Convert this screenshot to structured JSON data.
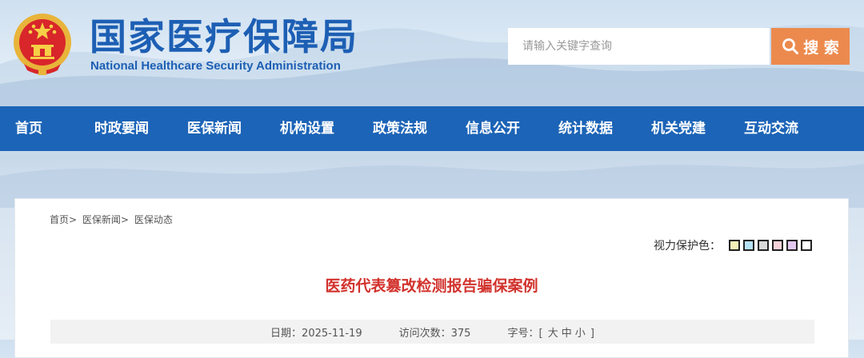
{
  "header": {
    "title_cn": "国家医疗保障局",
    "title_en": "National Healthcare Security Administration",
    "logo_icon": "national-emblem-icon"
  },
  "search": {
    "placeholder": "请输入关键字查询",
    "button_label": "搜 索",
    "button_icon": "search-icon",
    "button_color": "#ec8a4e"
  },
  "nav": {
    "color": "#1c64b7",
    "items": [
      "首页",
      "时政要闻",
      "医保新闻",
      "机构设置",
      "政策法规",
      "信息公开",
      "统计数据",
      "机关党建",
      "互动交流"
    ]
  },
  "breadcrumb": {
    "items": [
      "首页",
      "医保新闻",
      "医保动态"
    ],
    "separator": ">"
  },
  "eye_protection": {
    "label": "视力保护色：",
    "colors": [
      "#f4f0b8",
      "#b6e2f5",
      "#d8d8d8",
      "#f6d2d8",
      "#e3c9f2",
      "#ffffff"
    ]
  },
  "article": {
    "title": "医药代表篡改检测报告骗保案例",
    "title_color": "#d2322d",
    "date_label": "日期：",
    "date": "2025-11-19",
    "visits_label": "访问次数：",
    "visits": "375",
    "font_label": "字号：",
    "font_bracket_open": "[",
    "font_large": "大",
    "font_medium": "中",
    "font_small": "小",
    "font_bracket_close": "]"
  }
}
